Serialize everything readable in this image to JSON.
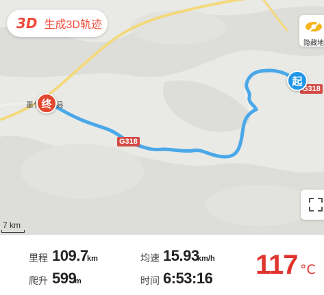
{
  "top_button": {
    "badge": "3D",
    "label": "生成3D轨迹"
  },
  "side_panel": {
    "hide_map_label": "隐藏地"
  },
  "map": {
    "start_marker": "起",
    "end_marker": "终",
    "road_tag_1": "G318",
    "road_tag_2": "G318",
    "county_label": "墨竹工卡县",
    "scale_label": "7 km",
    "route_color": "#4aa8e8",
    "start_color": "#2196e8",
    "end_color": "#e2482f"
  },
  "stats": {
    "distance_label": "里程",
    "distance_value": "109.7",
    "distance_unit": "km",
    "climb_label": "爬升",
    "climb_value": "599",
    "climb_unit": "m",
    "avg_speed_label": "均速",
    "avg_speed_value": "15.93",
    "avg_speed_unit": "km/h",
    "time_label": "时间",
    "time_value": "6:53:16",
    "temperature_value": "117",
    "temperature_unit": "°C"
  }
}
